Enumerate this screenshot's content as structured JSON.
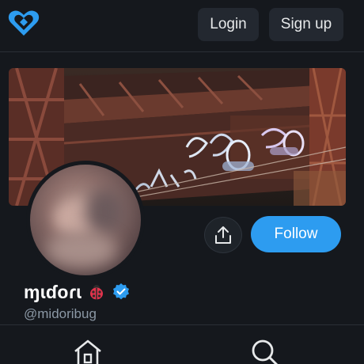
{
  "header": {
    "logo_icon": "heart-logo-icon",
    "login_label": "Login",
    "signup_label": "Sign up"
  },
  "profile": {
    "banner_image": "graffiti-bridge-banner",
    "avatar_image": "blurred-avatar",
    "display_name": "ɱɩɗoɾɩ",
    "emoji_icon": "ladybug-icon",
    "verified_icon": "verified-badge-icon",
    "handle": "@midoribug"
  },
  "actions": {
    "share_icon": "share-icon",
    "follow_label": "Follow"
  },
  "bottom_nav": {
    "items": [
      "home-icon",
      "search-icon"
    ]
  },
  "colors": {
    "background": "#15181d",
    "accent": "#2d9cf0",
    "logo": "#2d9cf0",
    "handle_text": "#8b98a5"
  }
}
